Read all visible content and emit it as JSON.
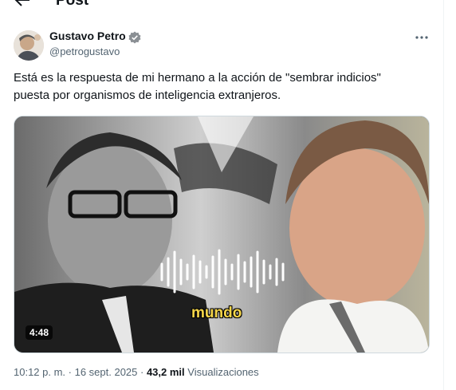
{
  "header": {
    "title": "Post",
    "back_icon": "arrow-left-icon"
  },
  "author": {
    "name": "Gustavo Petro",
    "handle": "@petrogustavo",
    "verified_color": "#8a8f94",
    "more_icon": "more-horizontal-icon"
  },
  "tweet": {
    "lines": [
      "Está es la respuesta de mi hermano a la acción de \"sembrar indicios\"",
      "puesta por organismos de inteligencia extranjeros."
    ]
  },
  "media": {
    "duration": "4:48",
    "caption": "mundo",
    "caption_color": "#f6d64a"
  },
  "meta": {
    "timestamp": "10:12 p. m. · 16 sept. 2025",
    "separator": " · ",
    "views_count": "43,2 mil",
    "views_label": "Visualizaciones"
  }
}
